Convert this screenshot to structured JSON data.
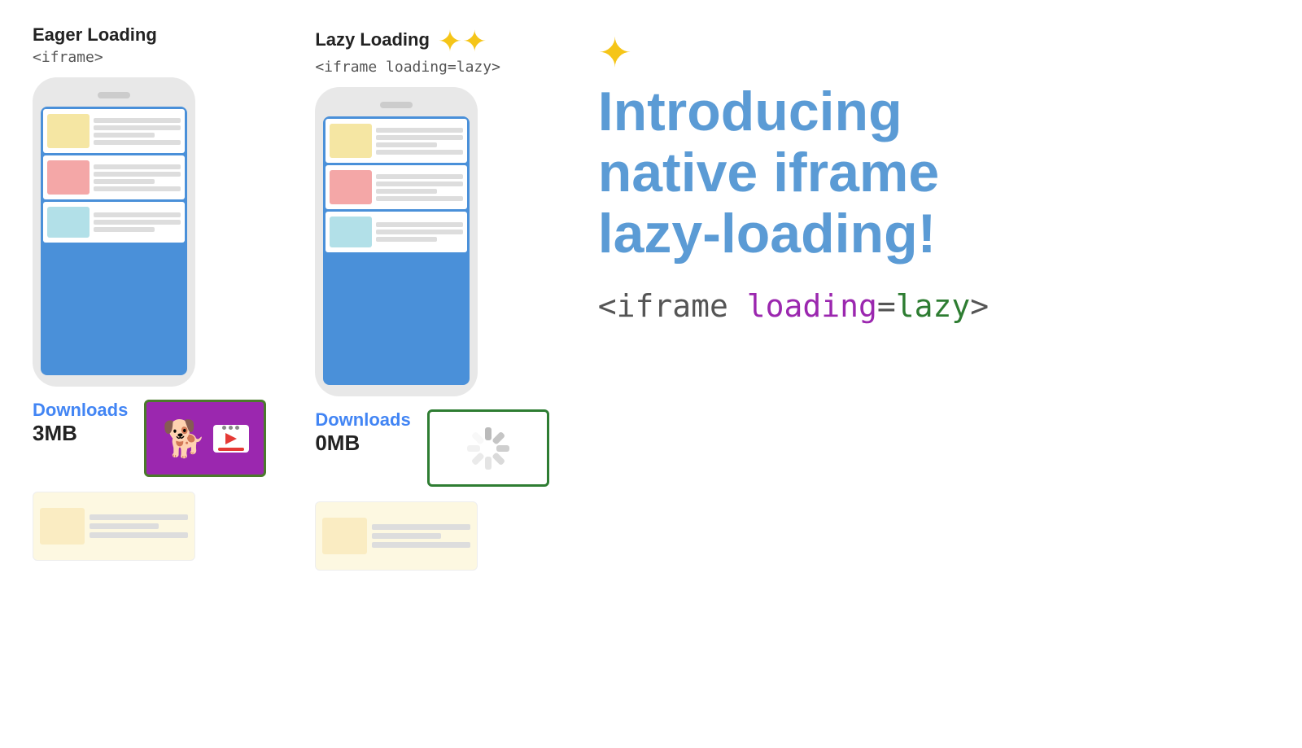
{
  "eager": {
    "label": "Eager Loading",
    "code": "<iframe>",
    "downloads_label": "Downloads",
    "downloads_size": "3MB",
    "blocks": [
      {
        "color": "#f5e6a3",
        "lines": 4
      },
      {
        "color": "#f4a7a7",
        "lines": 4
      },
      {
        "color": "#b2e0e8",
        "lines": 3
      }
    ]
  },
  "lazy": {
    "label": "Lazy Loading",
    "code": "<iframe loading=lazy>",
    "downloads_label": "Downloads",
    "downloads_size": "0MB",
    "blocks": [
      {
        "color": "#f5e6a3",
        "lines": 4
      },
      {
        "color": "#f4a7a7",
        "lines": 4
      },
      {
        "color": "#b2e0e8",
        "lines": 3
      }
    ]
  },
  "right": {
    "intro_line1": "Introducing",
    "intro_line2": "native iframe",
    "intro_line3": "lazy-loading!",
    "code_prefix": "<iframe ",
    "code_loading": "loading",
    "code_equals": "=",
    "code_lazy": "lazy",
    "code_suffix": ">"
  }
}
